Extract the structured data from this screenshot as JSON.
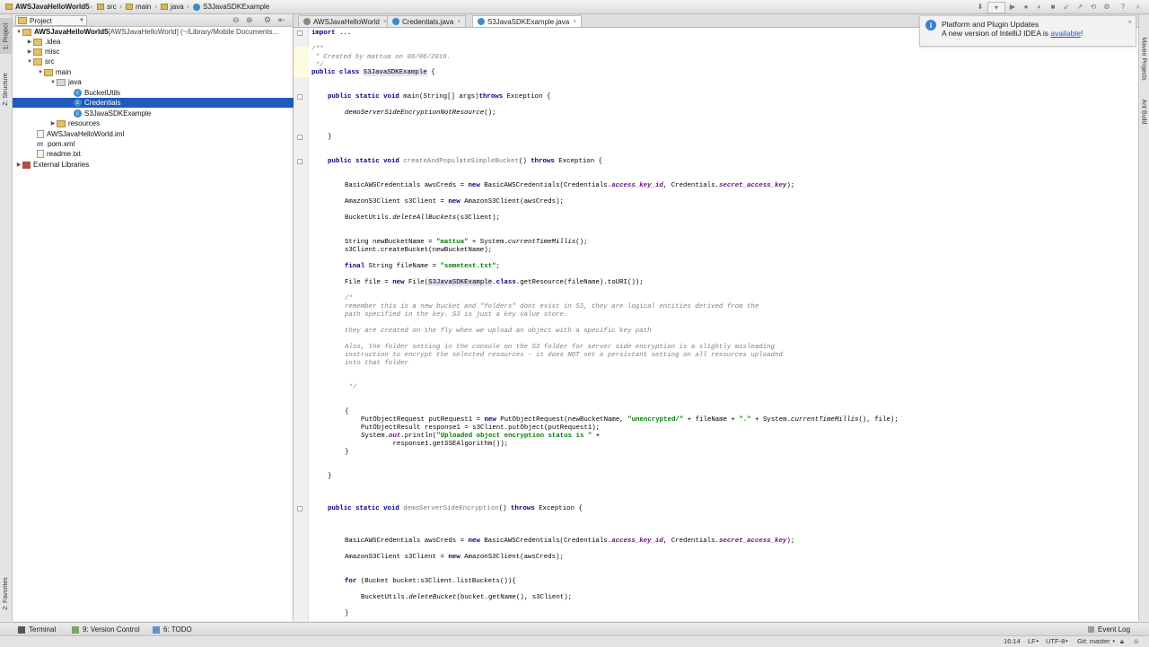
{
  "breadcrumb": [
    {
      "label": "AWSJavaHelloWorld5",
      "icon": "folder-icon"
    },
    {
      "label": "src",
      "icon": "folder-icon"
    },
    {
      "label": "main",
      "icon": "folder-icon"
    },
    {
      "label": "java",
      "icon": "folder-icon"
    },
    {
      "label": "S3JavaSDKExample",
      "icon": "class-icon"
    }
  ],
  "project_panel": {
    "title": "Project",
    "tree": [
      {
        "label": "AWSJavaHelloWorld5",
        "suffix": " [AWSJavaHelloWorld] (~/Library/Mobile Documents...",
        "type": "folder",
        "expanded": true
      },
      {
        "label": ".idea",
        "type": "folder",
        "expanded": false
      },
      {
        "label": "misc",
        "type": "folder",
        "expanded": false
      },
      {
        "label": "src",
        "type": "folder",
        "expanded": true
      },
      {
        "label": "main",
        "type": "folder",
        "expanded": true
      },
      {
        "label": "java",
        "type": "package",
        "expanded": true
      },
      {
        "label": "BucketUtils",
        "type": "class"
      },
      {
        "label": "Credentials",
        "type": "class",
        "selected": true
      },
      {
        "label": "S3JavaSDKExample",
        "type": "class"
      },
      {
        "label": "resources",
        "type": "folder",
        "expanded": false
      },
      {
        "label": "AWSJavaHelloWorld.iml",
        "type": "file"
      },
      {
        "label": "pom.xml",
        "type": "maven"
      },
      {
        "label": "readme.txt",
        "type": "file"
      },
      {
        "label": "External Libraries",
        "type": "library",
        "expanded": false
      }
    ]
  },
  "tool_strip": {
    "left": [
      "1: Project",
      "Z: Structure",
      "2: Favorites"
    ],
    "right": [
      "Maven Projects",
      "Ant Build"
    ]
  },
  "tabs": [
    {
      "label": "AWSJavaHelloWorld",
      "active": false
    },
    {
      "label": "Credentials.java",
      "active": false
    },
    {
      "label": "S3JavaSDKExample.java",
      "active": true
    }
  ],
  "notification": {
    "title": "Platform and Plugin Updates",
    "message": "A new version of IntelliJ IDEA is ",
    "link": "available",
    "end": "!"
  },
  "code": {
    "l_import": "import ...",
    "c1": "/**",
    "c2": " * Created by mattua on 06/06/2016.",
    "c3": " */",
    "class_kw": "public class ",
    "class_name": "S3JavaSDKExample",
    " class_open": " {",
    "m1_kw": "public static void ",
    "m1_sig": "main(String[] args)",
    "m1_throws": "throws ",
    "m1_exc": "Exception {",
    "m1_body": "demoServerSideEncryptionNotResource",
    "m1_body_end": "();",
    "close_brace": "}",
    "m2_kw": "public static void ",
    "m2_name": "createAndPopulateSimpleBucket",
    "m2_rest": "() ",
    "m2_throws": "throws ",
    "m2_exc": "Exception {",
    "cred_a": "BasicAWSCredentials awsCreds = ",
    "new_kw": "new ",
    "cred_b": "BasicAWSCredentials(Credentials.",
    "access_key": "access_key_id",
    ", ": "",
    "cred_c": ", Credentials.",
    "secret_key": "secret_access_key",
    "cred_d": ");",
    "s3c_a": "AmazonS3Client s3Client = ",
    "s3c_b": "AmazonS3Client(awsCreds);",
    "bu_a": "BucketUtils.",
    "bu_b": "deleteAllBuckets",
    "bu_c": "(s3Client);",
    "nb_a": "String newBucketName = ",
    "nb_str": "\"mattua\"",
    "nb_b": " + System.",
    "nb_c": "currentTimeMillis",
    "nb_d": "();",
    "cb": "s3Client.createBucket(newBucketName);",
    "fn_kw": "final ",
    "fn_a": "String fileName = ",
    "fn_str": "\"sometext.txt\"",
    "fn_b": ";",
    "ff_a": "File file = ",
    "ff_b": "File(",
    "ff_c": "S3JavaSDKExample",
    ".class_kw": "",
    "ff_d": ".class",
    ".rest": "",
    "ff_e": ".getResource(fileName).toURI());",
    "bc1": "/*",
    "bc2": "remember this is a new bucket and \"folders\" dont exist in S3, they are logical entities derived from the",
    "bc3": "path specified in the key. S3 is just a key value store.",
    "bc4": "they are created on the fly when we upload an object with a specific key path",
    "bc5": "Also, the folder setting in the console on the S3 folder for server side encryption is a slightly misleading",
    "bc6": "instruction to encrypt the selected resources - it does NOT set a persistant setting on all resources uploaded",
    "bc7": "into that folder",
    "bc8": " */",
    "open_brace": "{",
    "po_a": "PutObjectRequest putRequest1 = ",
    "po_b": "PutObjectRequest(newBucketName, ",
    "po_str1": "\"unencrypted/\"",
    "po_c": " + fileName + ",
    "po_str2": "\".\"",
    "po_d": " + System.",
    "po_e": "currentTimeMillis",
    "po_f": "(), file);",
    "pr": "PutObjectResult response1 = s3Client.putObject(putRequest1);",
    "sp_a": "System.",
    "sp_b": "out",
    ".x": "",
    "sp_c": ".println(",
    "sp_str": "\"Uploaded object encryption status is \"",
    "sp_d": " +",
    "sp2": "        response1.getSSEAlgorithm());",
    "m3_kw": "public static void ",
    "m3_name": "demoServerSideEncryption",
    "m3_rest": "() ",
    "m3_throws": "throws ",
    "m3_exc": "Exception {",
    "fb_kw": "for ",
    "fb_a": "(Bucket bucket:s3Client.listBuckets()){",
    "du_a": "BucketUtils.",
    "du_b": "deleteBucket",
    "du_c": "(bucket.getName(), s3Client);"
  },
  "bottom_tools": [
    {
      "label": "Terminal"
    },
    {
      "label": "9: Version Control"
    },
    {
      "label": "6: TODO"
    }
  ],
  "event_log": "Event Log",
  "status": {
    "position": "16:14",
    "line_sep": "LF‣",
    "encoding": "UTF-8‣",
    "vcs": "Git: master ‣"
  }
}
